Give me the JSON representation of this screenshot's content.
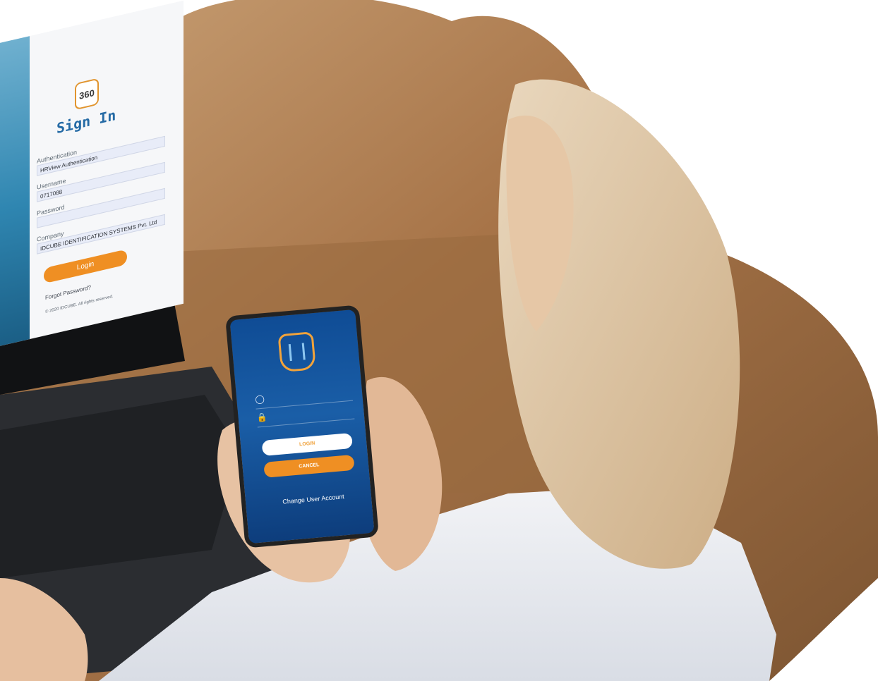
{
  "laptop": {
    "logo_text": "360",
    "title": "Sign In",
    "authentication_label": "Authentication",
    "authentication_value": "HRView Authentication",
    "username_label": "Username",
    "username_value": "0717088",
    "password_label": "Password",
    "company_label": "Company",
    "company_value": "IDCUBE IDENTIFICATION SYSTEMS Pvt. Ltd",
    "login_button": "Login",
    "forgot_password": "Forgot Password?",
    "copyright": "© 2020 IDCUBE. All rights reserved."
  },
  "phone": {
    "login_button": "LOGIN",
    "cancel_button": "CANCEL",
    "change_account": "Change User Account"
  },
  "colors": {
    "accent_orange": "#ef8f23",
    "title_blue": "#246aa5",
    "phone_blue": "#0f4c95"
  }
}
